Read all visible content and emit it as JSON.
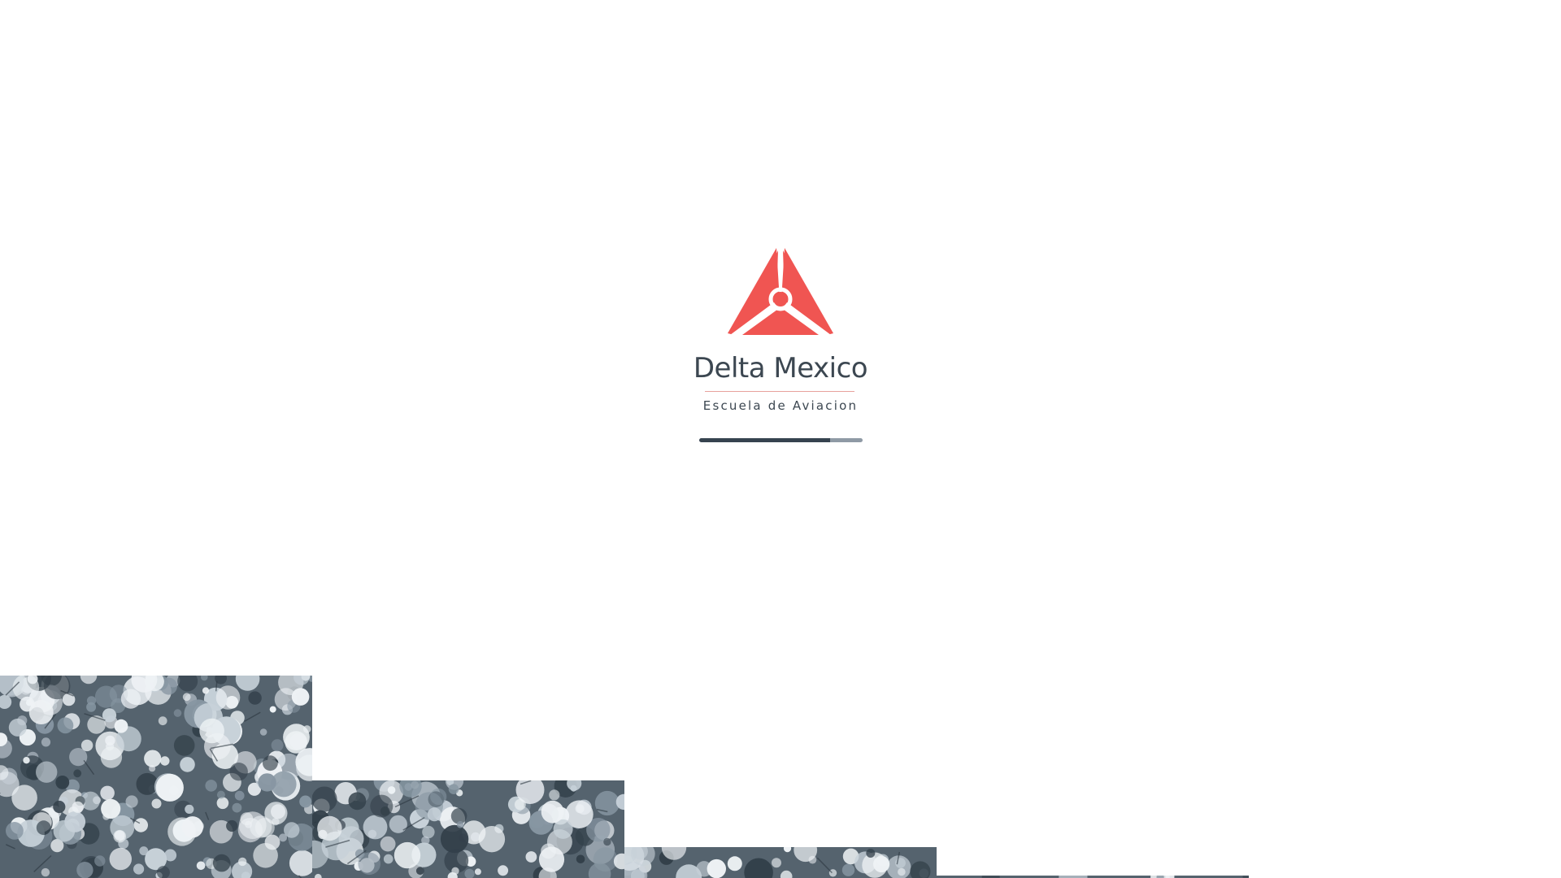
{
  "loader": {
    "brand_name": "Delta Mexico",
    "tagline": "Escuela de Aviacion",
    "logo_icon": "delta-propeller-logo-icon",
    "progress": 0.8
  },
  "colors": {
    "accent": "#f05552",
    "text": "#3c4751",
    "progress_fill": "#36434f",
    "progress_track": "#8f9aa5",
    "rule": "#e8a29c",
    "background": "#ffffff"
  },
  "decoration": {
    "background_image": "snowy-forest-aerial-photo"
  }
}
